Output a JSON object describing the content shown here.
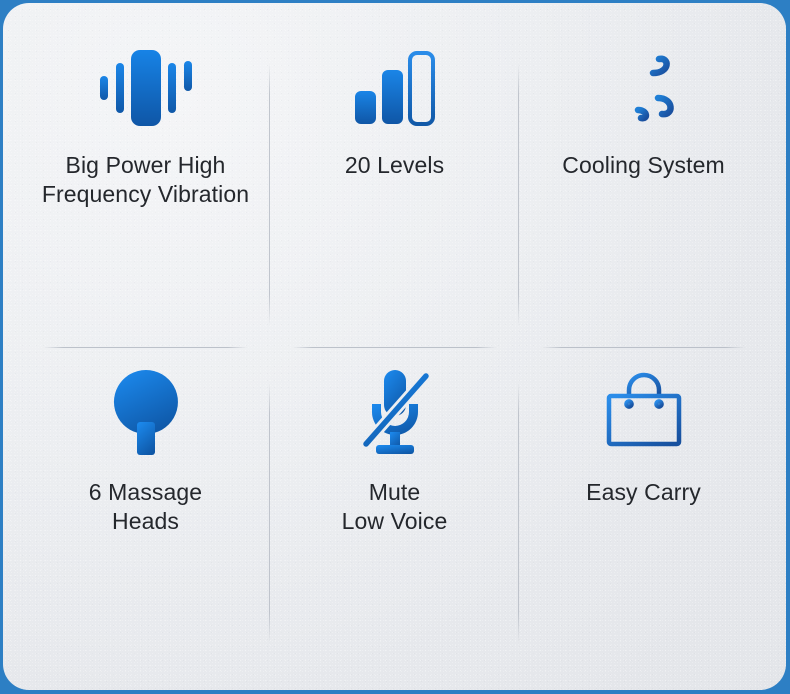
{
  "panel": {
    "border_color": "#2d7fc4",
    "background_color": "#ebedf0",
    "accent_blue_light": "#1583e4",
    "accent_blue_dark": "#0f56a4",
    "text_color": "#24272c"
  },
  "features": [
    {
      "icon": "vibration-icon",
      "label": "Big Power High\nFrequency Vibration"
    },
    {
      "icon": "levels-bars-icon",
      "label": "20 Levels"
    },
    {
      "icon": "cooling-wind-icon",
      "label": "Cooling System"
    },
    {
      "icon": "massage-head-icon",
      "label": "6 Massage\nHeads"
    },
    {
      "icon": "mute-microphone-icon",
      "label": "Mute\nLow Voice"
    },
    {
      "icon": "carry-bag-icon",
      "label": "Easy Carry"
    }
  ]
}
